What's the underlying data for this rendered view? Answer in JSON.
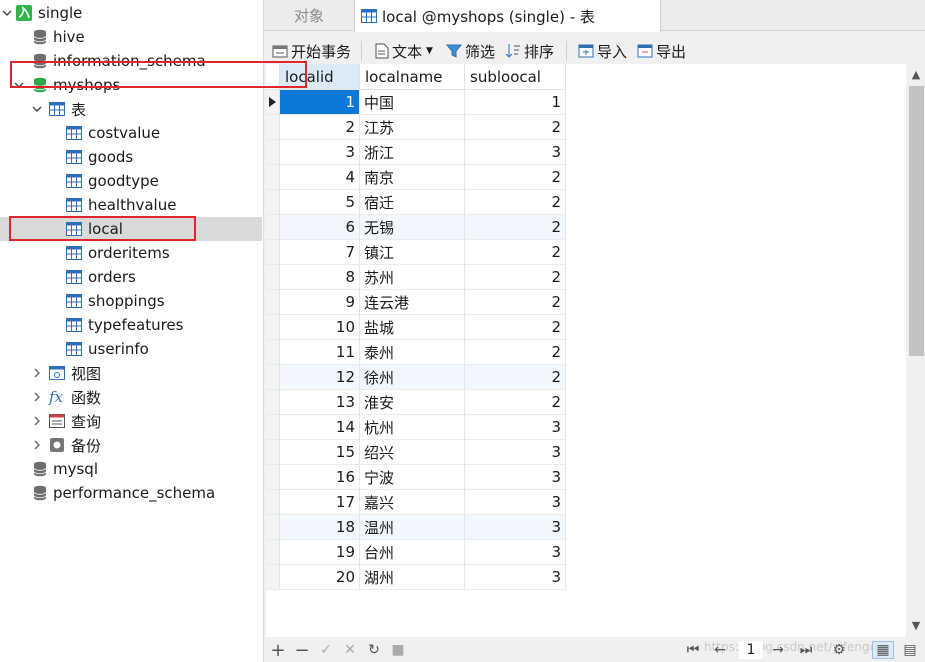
{
  "tree": {
    "connection": "single",
    "databases": [
      {
        "name": "hive"
      },
      {
        "name": "information_schema"
      },
      {
        "name": "myshops"
      },
      {
        "name": "mysql"
      },
      {
        "name": "performance_schema"
      }
    ],
    "tables_group": "表",
    "tables": [
      "costvalue",
      "goods",
      "goodtype",
      "healthvalue",
      "local",
      "orderitems",
      "orders",
      "shoppings",
      "typefeatures",
      "userinfo"
    ],
    "selected_table": "local",
    "other_groups": [
      "视图",
      "函数",
      "查询",
      "备份"
    ]
  },
  "tabs": {
    "objects": "对象",
    "active": "local @myshops (single) - 表"
  },
  "toolbar": {
    "begin_transaction": "开始事务",
    "text": "文本",
    "filter": "筛选",
    "sort": "排序",
    "import": "导入",
    "export": "导出"
  },
  "grid": {
    "columns": [
      "localid",
      "localname",
      "subloocal"
    ],
    "rows": [
      [
        "1",
        "中国",
        "1"
      ],
      [
        "2",
        "江苏",
        "2"
      ],
      [
        "3",
        "浙江",
        "3"
      ],
      [
        "4",
        "南京",
        "2"
      ],
      [
        "5",
        "宿迁",
        "2"
      ],
      [
        "6",
        "无锡",
        "2"
      ],
      [
        "7",
        "镇江",
        "2"
      ],
      [
        "8",
        "苏州",
        "2"
      ],
      [
        "9",
        "连云港",
        "2"
      ],
      [
        "10",
        "盐城",
        "2"
      ],
      [
        "11",
        "泰州",
        "2"
      ],
      [
        "12",
        "徐州",
        "2"
      ],
      [
        "13",
        "淮安",
        "2"
      ],
      [
        "14",
        "杭州",
        "3"
      ],
      [
        "15",
        "绍兴",
        "3"
      ],
      [
        "16",
        "宁波",
        "3"
      ],
      [
        "17",
        "嘉兴",
        "3"
      ],
      [
        "18",
        "温州",
        "3"
      ],
      [
        "19",
        "台州",
        "3"
      ],
      [
        "20",
        "湖州",
        "3"
      ]
    ]
  },
  "pager": {
    "page": "1"
  },
  "watermark": "https://blog.csdn.net/yifengdt",
  "colors": {
    "selection": "#0e78d7",
    "highlight_box": "#e0262c",
    "tree_selected": "#d9d9d9"
  }
}
